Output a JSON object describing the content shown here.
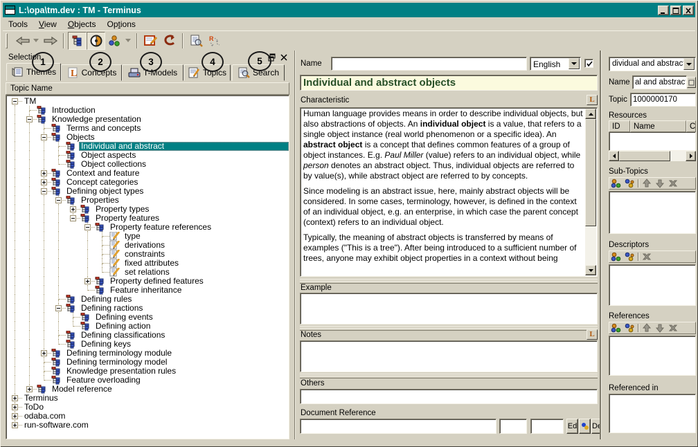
{
  "window": {
    "title": "L:\\opa\\tm.dev : TM - Terminus"
  },
  "menu": {
    "items": [
      {
        "label": "Tools",
        "underline": -1
      },
      {
        "label": "View",
        "underline": 0
      },
      {
        "label": "Objects",
        "underline": 0
      },
      {
        "label": "Options",
        "underline": 2
      }
    ]
  },
  "toolbar": {
    "buttons": [
      {
        "name": "back-button",
        "icon": "back"
      },
      {
        "name": "back-dropdown",
        "icon": "dropdown"
      },
      {
        "name": "forward-button",
        "icon": "forward"
      },
      {
        "name": "separator"
      },
      {
        "name": "tree-view-button",
        "icon": "tree",
        "pressed": true
      },
      {
        "name": "scope-button",
        "icon": "scope",
        "pressed": true
      },
      {
        "name": "objects-button",
        "icon": "balls"
      },
      {
        "name": "objects-dropdown",
        "icon": "dropdown"
      },
      {
        "name": "separator"
      },
      {
        "name": "edit-form-button",
        "icon": "editform"
      },
      {
        "name": "undo-button",
        "icon": "undo"
      },
      {
        "name": "separator"
      },
      {
        "name": "find-document-button",
        "icon": "docsearch"
      },
      {
        "name": "run-button",
        "icon": "run"
      }
    ]
  },
  "selection_panel": {
    "caption": "Selection",
    "tabs": [
      {
        "label": "Themes",
        "icon": "themes-icon",
        "active": true
      },
      {
        "label": "Concepts",
        "icon": "concepts-icon"
      },
      {
        "label": "T-Models",
        "icon": "tmodels-icon"
      },
      {
        "label": "Topics",
        "icon": "topics-icon"
      },
      {
        "label": "Search",
        "icon": "search-icon"
      }
    ],
    "annotations": [
      "1",
      "2",
      "3",
      "4",
      "5"
    ],
    "tree_header": "Topic Name",
    "tree_roots": [
      {
        "l": "TM",
        "e": "-",
        "children": [
          {
            "l": "Introduction",
            "i": "org"
          },
          {
            "l": "Knowledge presentation",
            "e": "-",
            "i": "org",
            "children": [
              {
                "l": "Terms and concepts",
                "i": "org"
              },
              {
                "l": "Objects",
                "e": "-",
                "i": "org",
                "children": [
                  {
                    "l": "Individual and abstract",
                    "i": "org",
                    "sel": true
                  },
                  {
                    "l": "Object aspects",
                    "i": "org"
                  },
                  {
                    "l": "Object collections",
                    "i": "org"
                  }
                ]
              },
              {
                "l": "Context and feature",
                "e": "+",
                "i": "org"
              },
              {
                "l": "Concept categories",
                "e": "+",
                "i": "org"
              },
              {
                "l": "Defining object types",
                "e": "-",
                "i": "org",
                "children": [
                  {
                    "l": "Properties",
                    "e": "-",
                    "i": "org",
                    "children": [
                      {
                        "l": "Property types",
                        "e": "+",
                        "i": "org"
                      },
                      {
                        "l": "Property features",
                        "e": "-",
                        "i": "org",
                        "children": [
                          {
                            "l": "Property feature references",
                            "e": "-",
                            "i": "org",
                            "children": [
                              {
                                "l": "type",
                                "i": "pencil"
                              },
                              {
                                "l": "derivations",
                                "i": "pencil"
                              },
                              {
                                "l": "constraints",
                                "i": "pencil"
                              },
                              {
                                "l": "fixed attributes",
                                "i": "pencil"
                              },
                              {
                                "l": "set relations",
                                "i": "pencil"
                              }
                            ]
                          },
                          {
                            "l": "Property defined features",
                            "e": "+",
                            "i": "org"
                          },
                          {
                            "l": "Feature inheritance",
                            "i": "org"
                          }
                        ]
                      }
                    ]
                  },
                  {
                    "l": "Defining rules",
                    "i": "org"
                  },
                  {
                    "l": "Defining ractions",
                    "e": "-",
                    "i": "org",
                    "children": [
                      {
                        "l": "Defining events",
                        "i": "org"
                      },
                      {
                        "l": "Defining action",
                        "i": "org"
                      }
                    ]
                  },
                  {
                    "l": "Defining classifications",
                    "i": "org"
                  },
                  {
                    "l": "Defining keys",
                    "i": "org"
                  }
                ]
              },
              {
                "l": "Defining terminology module",
                "e": "+",
                "i": "org"
              },
              {
                "l": "Defining terminology model",
                "i": "org"
              },
              {
                "l": "Knowledge presentation rules",
                "i": "org"
              },
              {
                "l": "Feature overloading",
                "i": "org"
              }
            ]
          },
          {
            "l": "Model reference",
            "e": "+",
            "i": "org"
          }
        ]
      },
      {
        "l": "Terminus",
        "e": "+"
      },
      {
        "l": "ToDo",
        "e": "+"
      },
      {
        "l": "odaba.com",
        "e": "+"
      },
      {
        "l": "run-software.com",
        "e": "+"
      }
    ]
  },
  "editor": {
    "name_label": "Name",
    "name_value": "",
    "language": "English",
    "title": "Individual and abstract objects",
    "characteristic_label": "Characteristic",
    "paragraphs": [
      {
        "segments": [
          {
            "t": "Human language provides means in order to describe individual objects, but also abstractions of objects. An "
          },
          {
            "t": "individual object",
            "b": true
          },
          {
            "t": " is a value, that refers to a single object instance (real world phenomenon or a specific idea). An "
          },
          {
            "t": "abstract object",
            "b": true
          },
          {
            "t": " is a concept that defines common features of a group of object instances. E.g. "
          },
          {
            "t": "Paul Miller",
            "i": true
          },
          {
            "t": " (value) refers to an individual object, while "
          },
          {
            "t": "person",
            "i": true
          },
          {
            "t": " denotes an abstract object. Thus, individual objects are referred to by value(s), while abstract object are referred to by concepts."
          }
        ]
      },
      {
        "segments": [
          {
            "t": "Since modeling is an abstract issue, here, mainly abstract objects will be considered. In some cases, terminology, however, is defined in the context of an individual object, e.g. an enterprise, in which case the parent concept (context) refers to an individual object."
          }
        ]
      },
      {
        "segments": [
          {
            "t": "Typically, the meaning of abstract objects is transferred by means of examples (\"This is a tree\"). After being introduced to a sufficient number of trees, anyone may exhibit object properties in a context without being"
          }
        ]
      }
    ],
    "example_label": "Example",
    "notes_label": "Notes",
    "others_label": "Others",
    "docref_label": "Document Reference",
    "docref_buttons": [
      "Ed",
      "Del"
    ]
  },
  "details": {
    "combo_value": "dividual and abstract",
    "name_label": "Name",
    "name_value": "al and abstract",
    "topic_label": "Topic",
    "topic_value": "1000000170",
    "resources_label": "Resources",
    "resources_columns": [
      "ID",
      "Name",
      "C"
    ],
    "subtopics_label": "Sub-Topics",
    "subtopics_toolbar": [
      "add",
      "insert",
      "sep",
      "up",
      "down",
      "delete"
    ],
    "descriptors_label": "Descriptors",
    "descriptors_toolbar": [
      "add",
      "insert",
      "sep",
      "delete"
    ],
    "references_label": "References",
    "references_toolbar": [
      "add",
      "insert",
      "sep",
      "up",
      "down",
      "delete"
    ],
    "referenced_in_label": "Referenced in"
  }
}
